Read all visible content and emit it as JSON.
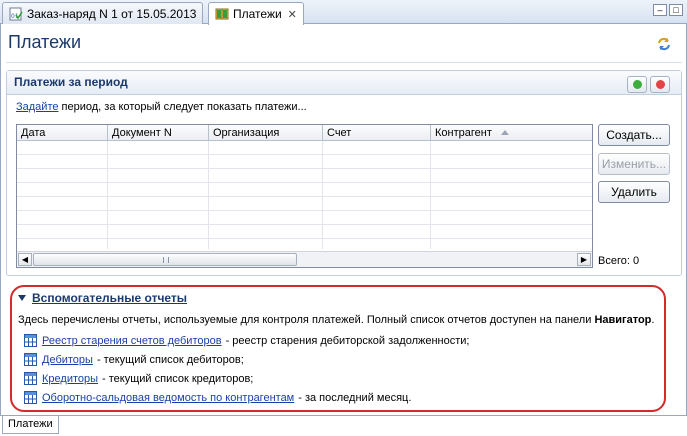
{
  "tabs": [
    {
      "label": "Заказ-наряд N 1 от 15.05.2013",
      "active": false
    },
    {
      "label": "Платежи",
      "active": true
    }
  ],
  "page": {
    "title": "Платежи"
  },
  "payments": {
    "section_title": "Платежи за период",
    "hint_link": "Задайте",
    "hint_text": " период, за который следует показать платежи...",
    "columns": [
      "Дата",
      "Документ N",
      "Организация",
      "Счет",
      "Контрагент"
    ],
    "buttons": {
      "create": "Создать...",
      "edit": "Изменить...",
      "delete": "Удалить"
    },
    "total": "Всего: 0"
  },
  "reports": {
    "title": "Вспомогательные отчеты",
    "desc_text": "Здесь перечислены отчеты, используемые для контроля платежей. Полный список отчетов доступен на панели ",
    "desc_bold": "Навигатор",
    "desc_end": ".",
    "items": [
      {
        "link": "Реестр старения счетов дебиторов",
        "text": "- реестр старения дебиторской задолженности;"
      },
      {
        "link": "Дебиторы",
        "text": "- текущий список дебиторов;"
      },
      {
        "link": "Кредиторы",
        "text": "- текущий список кредиторов;"
      },
      {
        "link": "Оборотно-сальдовая ведомость по контрагентам",
        "text": "- за последний месяц."
      }
    ]
  },
  "bottom_tab": "Платежи",
  "colors": {
    "accent": "#1b3a6b",
    "link": "#1a3fa8",
    "highlight": "#d42a2a",
    "green": "#3cae3c",
    "red": "#e04444"
  }
}
